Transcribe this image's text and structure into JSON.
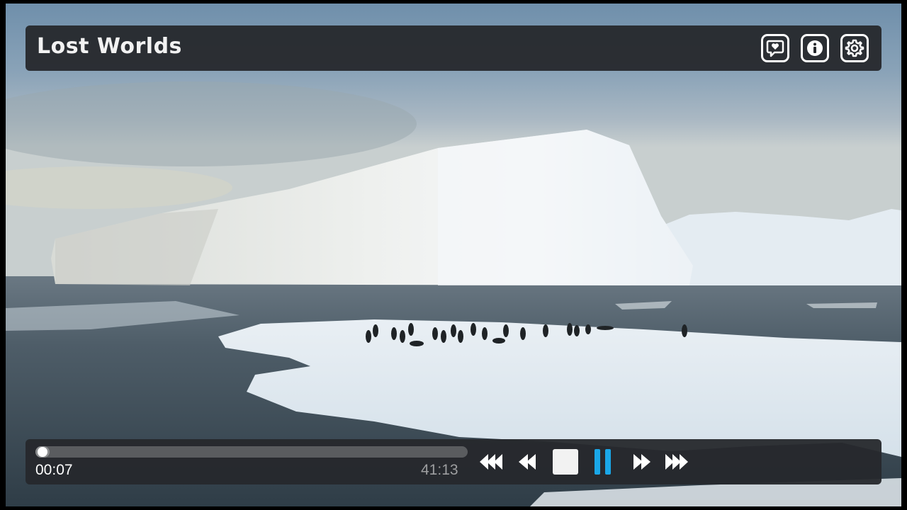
{
  "player": {
    "title": "Lost Worlds",
    "accent_color": "#1aa7e8",
    "state": "playing"
  },
  "top_controls": [
    {
      "name": "comment-button",
      "icon": "speech-bubble-heart-icon"
    },
    {
      "name": "info-button",
      "icon": "info-icon"
    },
    {
      "name": "settings-button",
      "icon": "gear-icon"
    }
  ],
  "playback": {
    "current_time": "00:07",
    "total_time": "41:13",
    "progress_fraction": 0.003
  },
  "transport": [
    {
      "name": "skip-back-button",
      "icon": "triple-left-arrow-icon"
    },
    {
      "name": "rewind-button",
      "icon": "double-left-arrow-icon"
    },
    {
      "name": "stop-button",
      "icon": "stop-icon"
    },
    {
      "name": "pause-button",
      "icon": "pause-icon"
    },
    {
      "name": "fast-forward-button",
      "icon": "double-right-arrow-icon"
    },
    {
      "name": "skip-forward-button",
      "icon": "triple-right-arrow-icon"
    }
  ]
}
